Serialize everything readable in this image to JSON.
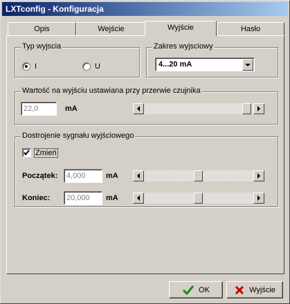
{
  "window": {
    "title": "LXTconfig - Konfiguracja"
  },
  "tabs": [
    {
      "label": "Opis",
      "active": false
    },
    {
      "label": "Wejście",
      "active": false
    },
    {
      "label": "Wyjście",
      "active": true
    },
    {
      "label": "Hasło",
      "active": false
    }
  ],
  "output_type": {
    "title": "Typ wyjscia",
    "options": [
      {
        "label": "I",
        "selected": true
      },
      {
        "label": "U",
        "selected": false
      }
    ]
  },
  "output_range": {
    "title": "Zakres wyjsciowy",
    "selected": "4...20 mA"
  },
  "sensor_break": {
    "title": "Wartość na wyjściu ustawiana przy przerwie czujnika",
    "value": "22,0",
    "unit": "mA",
    "slider_fraction": 1.0
  },
  "tuning": {
    "title": "Dostrojenie sygnału wyjściowego",
    "change_label": "Zmień",
    "change_checked": true,
    "start": {
      "label": "Początek:",
      "value": "4,000",
      "unit": "mA",
      "slider_fraction": 0.5
    },
    "end": {
      "label": "Koniec:",
      "value": "20,000",
      "unit": "mA",
      "slider_fraction": 0.5
    }
  },
  "buttons": {
    "ok": "OK",
    "exit": "Wyjście"
  },
  "colors": {
    "ok_check": "#1a8f1a",
    "exit_x": "#c00000"
  }
}
